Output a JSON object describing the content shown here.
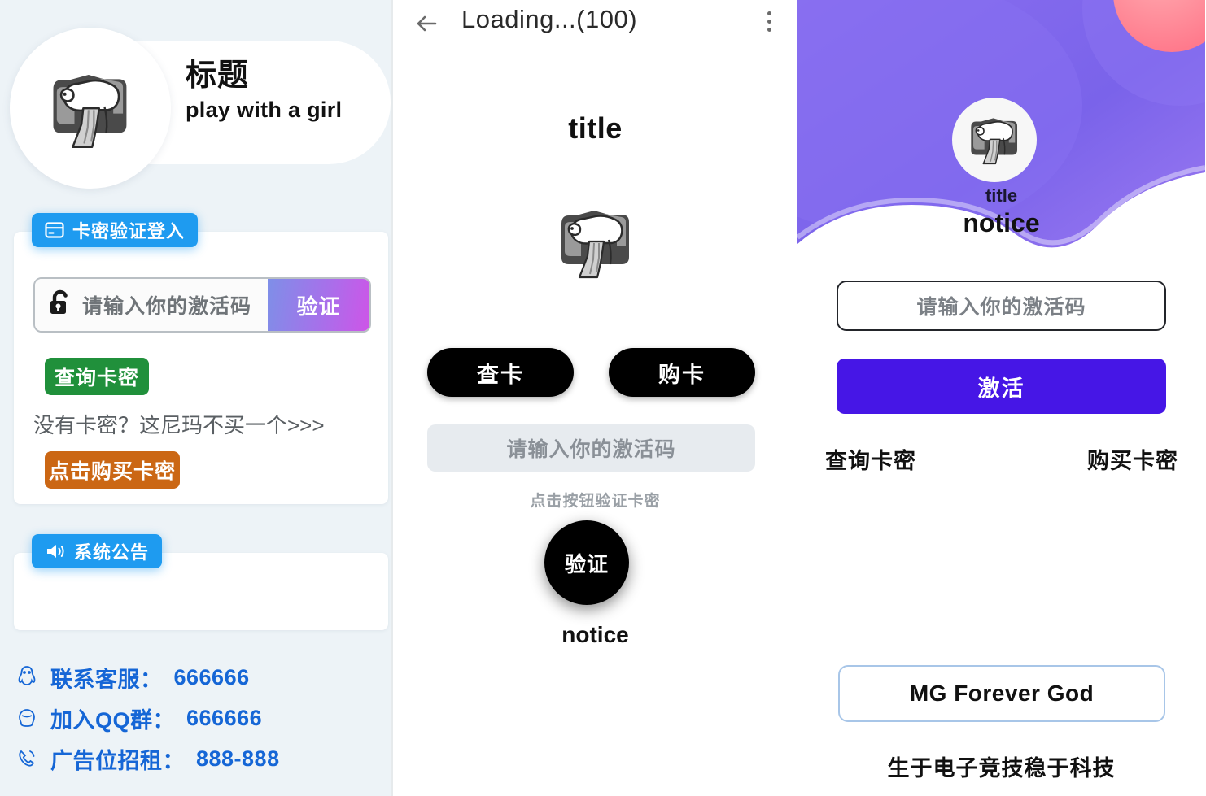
{
  "left_panel": {
    "hero": {
      "logo_icon": "bear-on-sofa-logo",
      "title": "标题",
      "subtitle": "play with a girl"
    },
    "login_card": {
      "badge_icon": "card-icon",
      "badge_label": "卡密验证登入",
      "input": {
        "icon": "unlock-icon",
        "value": "",
        "placeholder": "请输入你的激活码"
      },
      "verify_button": "验证",
      "query_button": "查询卡密",
      "no_card_text": "没有卡密？这尼玛不买一个>>>",
      "buy_button": "点击购买卡密"
    },
    "notice_card": {
      "badge_icon": "speaker-icon",
      "badge_label": "系统公告",
      "body": ""
    },
    "contacts": [
      {
        "icon": "qq-penguin-icon",
        "label": "联系客服：",
        "value": "666666"
      },
      {
        "icon": "qq-group-icon",
        "label": "加入QQ群：",
        "value": "666666"
      },
      {
        "icon": "phone-icon",
        "label": "广告位招租：",
        "value": "888-888"
      }
    ]
  },
  "mid_panel": {
    "topbar": {
      "back_icon": "arrow-left-icon",
      "title": "Loading...(100)",
      "menu_icon": "more-vertical-icon"
    },
    "title": "title",
    "logo_icon": "bear-on-sofa-logo",
    "check_card_button": "查卡",
    "buy_card_button": "购卡",
    "input": {
      "value": "",
      "placeholder": "请输入你的激活码"
    },
    "hint": "点击按钮验证卡密",
    "verify_circle_button": "验证",
    "notice": "notice"
  },
  "right_panel": {
    "hero": {
      "avatar_icon": "bear-on-sofa-logo",
      "title": "title",
      "notice": "notice"
    },
    "input": {
      "value": "",
      "placeholder": "请输入你的激活码"
    },
    "activate_button": "激活",
    "links": {
      "query": "查询卡密",
      "buy": "购买卡密"
    },
    "footer_box": "MG Forever God",
    "slogan": "生于电子竞技稳于科技"
  },
  "colors": {
    "left_bg": "#edf3f7",
    "badge_blue": "#1e9bf0",
    "green": "#20903b",
    "orange": "#cb6714",
    "link_blue": "#1566d6",
    "verify_gradient_from": "#7e8fe8",
    "verify_gradient_to": "#ce55e8",
    "hero_purple": "#7a63ea",
    "hero_pink": "#ff8a98",
    "activate_purple": "#4616e6"
  }
}
